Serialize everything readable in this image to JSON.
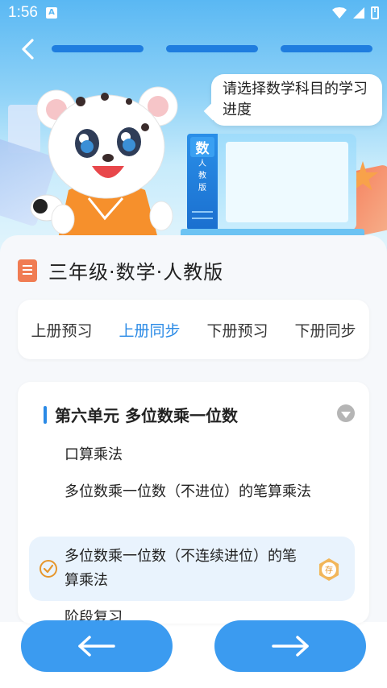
{
  "status_bar": {
    "time": "1:56",
    "notification_glyph": "A"
  },
  "header": {
    "speech_text": "请选择数学科目的学习进度",
    "book_spine": {
      "subject": "数",
      "edition_chars": [
        "人",
        "教",
        "版"
      ]
    }
  },
  "content": {
    "page_title": "三年级·数学·人教版",
    "tabs": [
      {
        "label": "上册预习",
        "active": false
      },
      {
        "label": "上册同步",
        "active": true
      },
      {
        "label": "下册预习",
        "active": false
      },
      {
        "label": "下册同步",
        "active": false
      }
    ],
    "unit": {
      "title": "第六单元 多位数乘一位数",
      "lessons": [
        {
          "label": "口算乘法"
        },
        {
          "label": "多位数乘一位数（不进位）的笔算乘法"
        },
        {
          "label": "多位数乘一位数（不连续进位）的笔算乘法",
          "selected": true,
          "badge": "存"
        },
        {
          "label": "阶段复习"
        }
      ]
    }
  },
  "colors": {
    "accent": "#2a8ae6",
    "nav_button": "#3b9bf0",
    "selected_bg": "#e9f3fd",
    "badge": "#e6962c"
  },
  "icons": {
    "back": "chevron-left-icon",
    "prev": "arrow-left-icon",
    "next": "arrow-right-icon"
  }
}
